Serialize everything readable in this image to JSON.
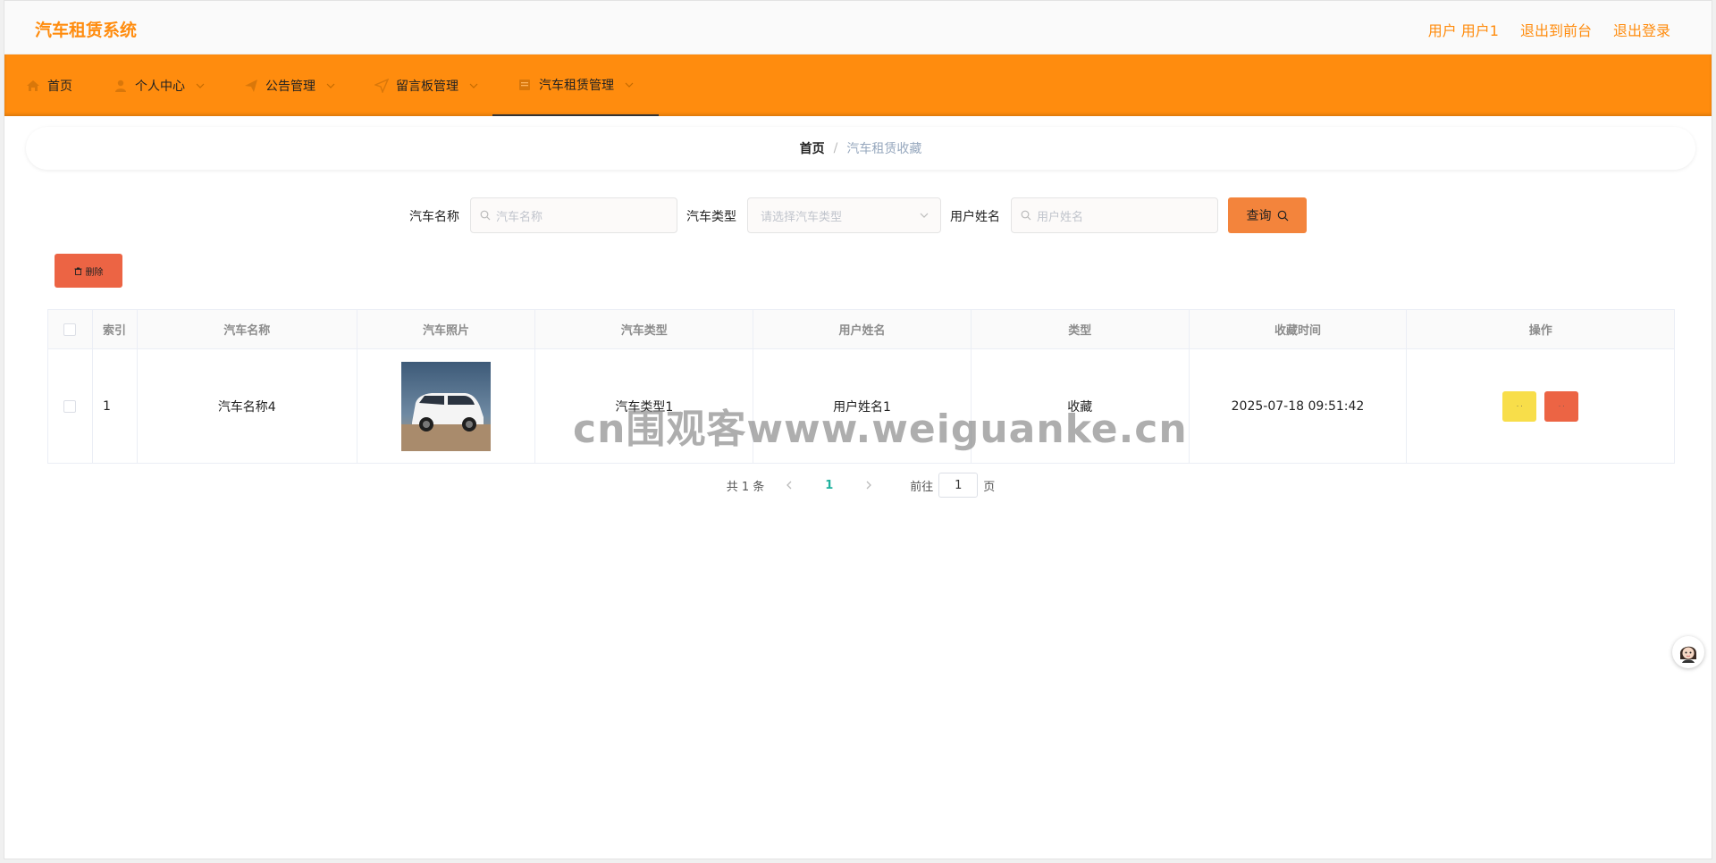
{
  "header": {
    "app_title": "汽车租赁系统",
    "user_label": "用户 用户1",
    "back_to_front": "退出到前台",
    "logout": "退出登录"
  },
  "nav": {
    "items": [
      {
        "label": "首页",
        "icon": "home-icon"
      },
      {
        "label": "个人中心",
        "icon": "user-icon"
      },
      {
        "label": "公告管理",
        "icon": "send-icon"
      },
      {
        "label": "留言板管理",
        "icon": "navigation-icon"
      },
      {
        "label": "汽车租赁管理",
        "icon": "document-icon"
      }
    ],
    "active_index": 4
  },
  "breadcrumb": {
    "home": "首页",
    "separator": "/",
    "current": "汽车租赁收藏"
  },
  "search": {
    "car_name_label": "汽车名称",
    "car_name_placeholder": "汽车名称",
    "car_type_label": "汽车类型",
    "car_type_placeholder": "请选择汽车类型",
    "user_name_label": "用户姓名",
    "user_name_placeholder": "用户姓名",
    "query_label": "查询"
  },
  "actions": {
    "delete_label": "删除"
  },
  "table": {
    "headers": [
      "索引",
      "汽车名称",
      "汽车照片",
      "汽车类型",
      "用户姓名",
      "类型",
      "收藏时间",
      "操作"
    ],
    "rows": [
      {
        "index": "1",
        "car_name": "汽车名称4",
        "car_type": "汽车类型1",
        "user_name": "用户姓名1",
        "kind": "收藏",
        "time": "2025-07-18 09:51:42"
      }
    ]
  },
  "pagination": {
    "total_text": "共 1 条",
    "current_page": "1",
    "goto_label": "前往",
    "goto_value": "1",
    "page_suffix": "页"
  },
  "watermark": "cn围观客www.weiguanke.cn",
  "colors": {
    "accent": "#ff8c0e",
    "query_button": "#f3843c",
    "delete_button": "#ec6444",
    "detail_button": "#f8de4a",
    "active_page": "#1fb19e"
  }
}
